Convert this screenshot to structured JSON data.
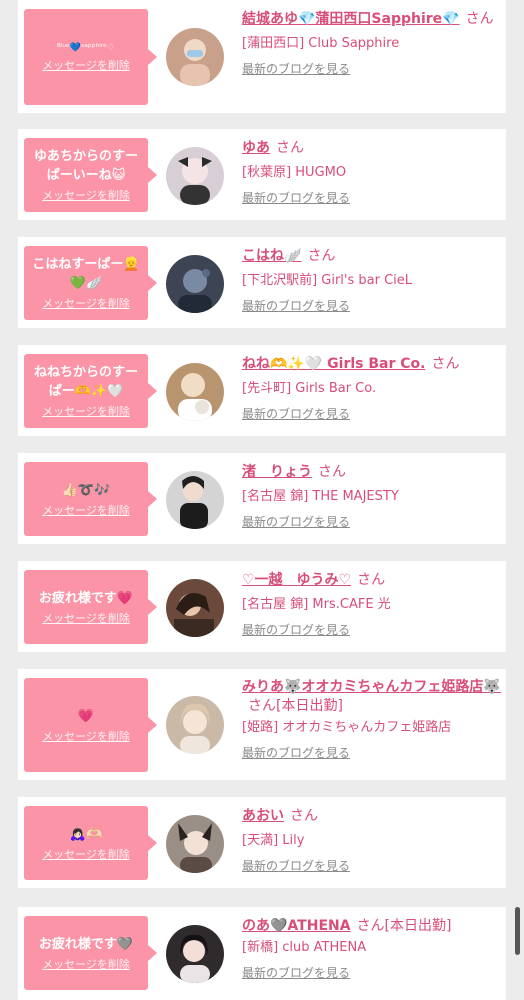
{
  "entries": [
    {
      "message": "ᴮˡᵘᵉ💙ˢᵃᵖᵖʰⁱʳᵉ♢",
      "delete_label": "メッセージを削除",
      "name": "結城あゆ💎蒲田西口Sapphire💎",
      "san": "さん",
      "shop": "[蒲田西口] Club Sapphire",
      "blog": "最新のブログを見る",
      "avatar_color": "#c9a08a"
    },
    {
      "message": "ゆあちからのすーぱーいーね😺",
      "delete_label": "メッセージを削除",
      "name": "ゆあ",
      "san": "さん",
      "shop": "[秋葉原] HUGMO",
      "blog": "最新のブログを見る",
      "avatar_color": "#d8cfd6"
    },
    {
      "message": "こはねすーぱー👱💚🪽",
      "delete_label": "メッセージを削除",
      "name": "こはね🪽",
      "san": "さん",
      "shop": "[下北沢駅前] Girl's bar CieL",
      "blog": "最新のブログを見る",
      "avatar_color": "#3d4454"
    },
    {
      "message": "ねねちからのすーぱー🫶✨🤍",
      "delete_label": "メッセージを削除",
      "name": "ねね🫶✨🤍 Girls Bar Co.",
      "san": "さん",
      "shop": "[先斗町] Girls Bar Co.",
      "blog": "最新のブログを見る",
      "avatar_color": "#b8956f"
    },
    {
      "message": "👍🏻➰🎶",
      "delete_label": "メッセージを削除",
      "name": "渚　りょう",
      "san": "さん",
      "shop": "[名古屋 錦] THE MAJESTY",
      "blog": "最新のブログを見る",
      "avatar_color": "#5a5a5a"
    },
    {
      "message": "お疲れ様です💗",
      "delete_label": "メッセージを削除",
      "name": "♡一越　ゆうみ♡",
      "san": "さん",
      "shop": "[名古屋 錦] Mrs.CAFE 光",
      "blog": "最新のブログを見る",
      "avatar_color": "#6b4a3c"
    },
    {
      "message": "💗",
      "delete_label": "メッセージを削除",
      "name": "みりあ🐺オオカミちゃんカフェ姫路店🐺",
      "san": "さん[本日出勤]",
      "shop": "[姫路] オオカミちゃんカフェ姫路店",
      "blog": "最新のブログを見る",
      "avatar_color": "#cbb9a8"
    },
    {
      "message": "🙇🏻‍♀️🫶🏻",
      "delete_label": "メッセージを削除",
      "name": "あおい",
      "san": "さん",
      "shop": "[天満] Lily",
      "blog": "最新のブログを見る",
      "avatar_color": "#9a8f86"
    },
    {
      "message": "お疲れ様です🩶",
      "delete_label": "メッセージを削除",
      "name": "のあ🩶ATHENA",
      "san": "さん[本日出勤]",
      "shop": "[新橋] club ATHENA",
      "blog": "最新のブログを見る",
      "avatar_color": "#2f2a2c"
    }
  ],
  "colors": {
    "accent": "#d94e79",
    "bubble": "#fb94a6",
    "background": "#ececec"
  }
}
